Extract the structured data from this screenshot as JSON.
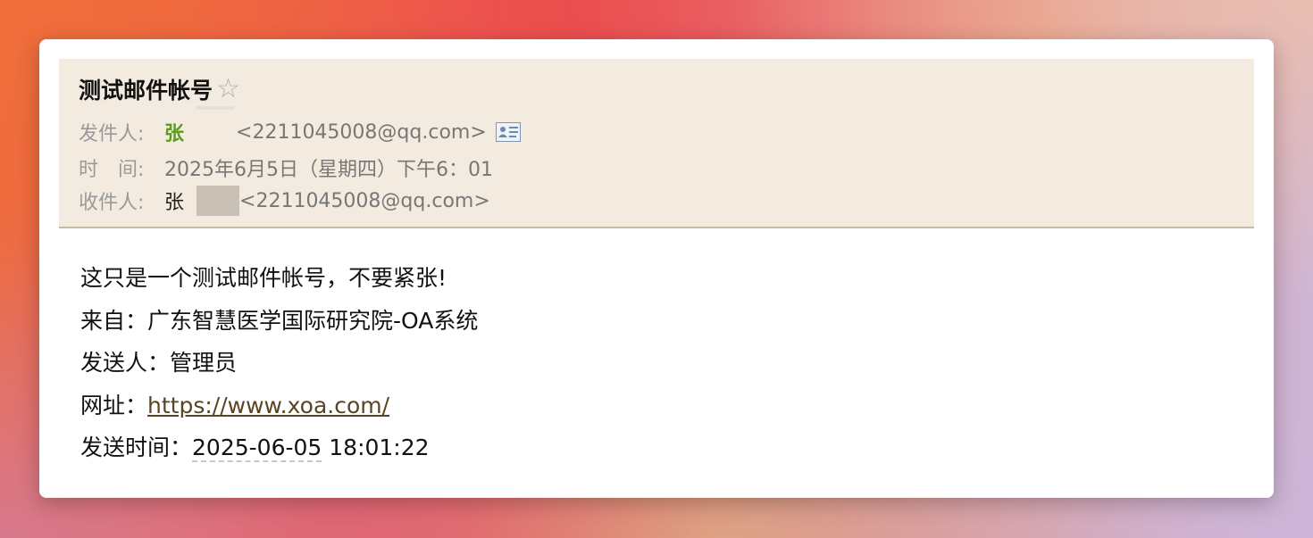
{
  "email": {
    "subject": "测试邮件帐号",
    "star_icon": "star-outline-icon",
    "from": {
      "label": "发件人:",
      "name": "张",
      "address": "<2211045008@qq.com>",
      "contact_icon": "contact-card-icon"
    },
    "time": {
      "label": "时　间:",
      "value": "2025年6月5日（星期四）下午6：01"
    },
    "to": {
      "label": "收件人:",
      "name": "张",
      "address": "<2211045008@qq.com>"
    },
    "body": {
      "line1": "这只是一个测试邮件帐号，不要紧张!",
      "source_label": "来自：",
      "source_value": "广东智慧医学国际研究院-OA系统",
      "sender_label": "发送人：",
      "sender_value": "管理员",
      "url_label": "网址：",
      "url_value": "https://www.xoa.com/",
      "sent_label": "发送时间：",
      "sent_date": "2025-06-05",
      "sent_time": " 18:01:22"
    }
  }
}
